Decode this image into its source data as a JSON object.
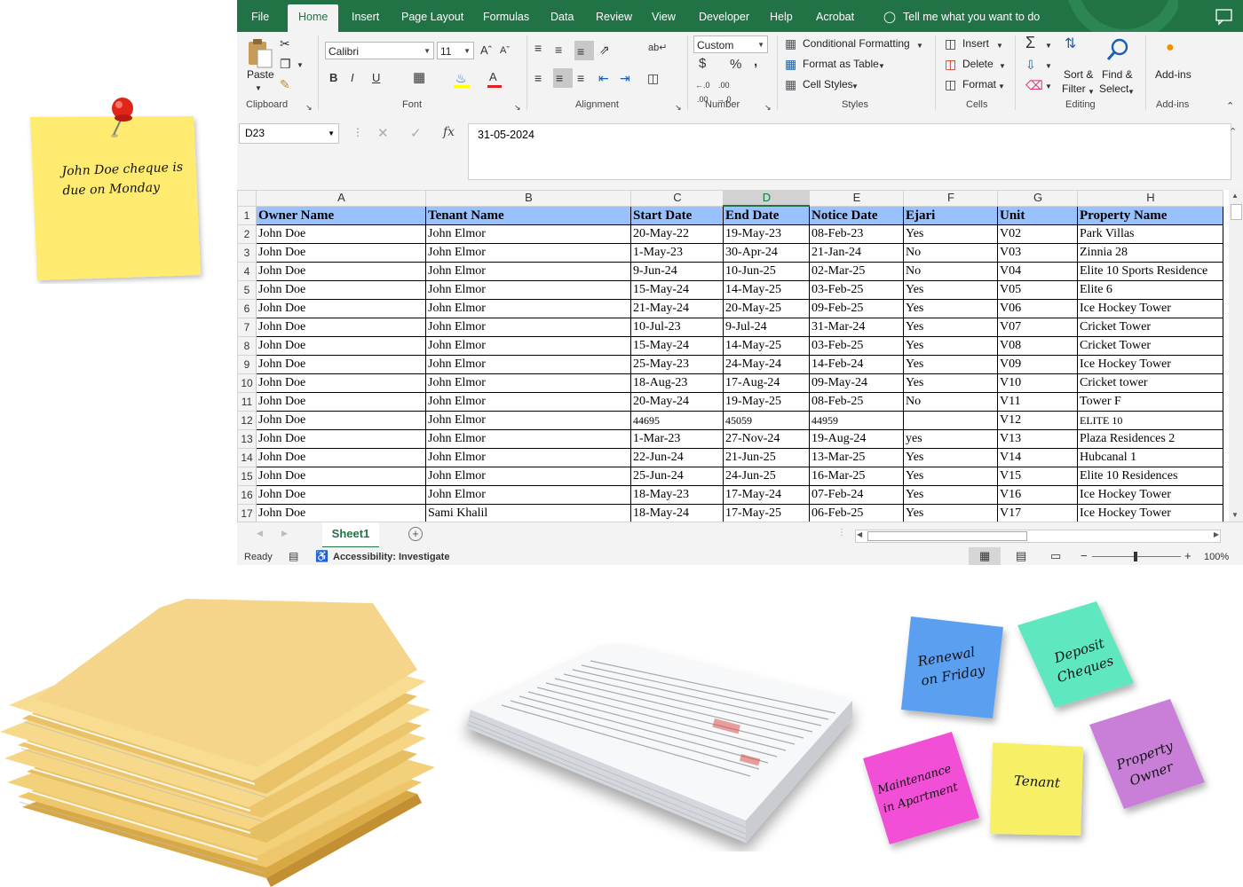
{
  "ribbon_tabs": [
    "File",
    "Home",
    "Insert",
    "Page Layout",
    "Formulas",
    "Data",
    "Review",
    "View",
    "Developer",
    "Help",
    "Acrobat"
  ],
  "tell_me": "Tell me what you want to do",
  "clipboard": {
    "paste": "Paste",
    "group": "Clipboard"
  },
  "font": {
    "name": "Calibri",
    "size": "11",
    "group": "Font"
  },
  "alignment": {
    "group": "Alignment"
  },
  "number": {
    "format": "Custom",
    "group": "Number",
    "currency": "$",
    "percent": "%",
    "comma": ","
  },
  "styles": {
    "conditional": "Conditional Formatting",
    "format_table": "Format as Table",
    "cell_styles": "Cell Styles",
    "group": "Styles"
  },
  "cells": {
    "insert": "Insert",
    "delete": "Delete",
    "format": "Format",
    "group": "Cells"
  },
  "editing": {
    "sort": "Sort &",
    "filter": "Filter",
    "find": "Find &",
    "select": "Select",
    "group": "Editing"
  },
  "addins": {
    "label": "Add-ins",
    "group": "Add-ins"
  },
  "name_box": "D23",
  "formula_value": "31-05-2024",
  "columns": [
    "A",
    "B",
    "C",
    "D",
    "E",
    "F",
    "G",
    "H"
  ],
  "headers": [
    "Owner Name",
    "Tenant Name",
    "Start Date",
    "End Date",
    "Notice Date",
    "Ejari",
    "Unit",
    "Property Name"
  ],
  "rows": [
    [
      "John Doe",
      "John Elmor",
      "20-May-22",
      "19-May-23",
      "08-Feb-23",
      "Yes",
      "V02",
      "Park Villas"
    ],
    [
      "John Doe",
      "John Elmor",
      "1-May-23",
      "30-Apr-24",
      "21-Jan-24",
      "No",
      "V03",
      "Zinnia 28"
    ],
    [
      "John Doe",
      "John Elmor",
      "9-Jun-24",
      "10-Jun-25",
      "02-Mar-25",
      "No",
      "V04",
      "Elite 10 Sports Residence"
    ],
    [
      "John Doe",
      "John Elmor",
      "15-May-24",
      "14-May-25",
      "03-Feb-25",
      "Yes",
      "V05",
      "Elite 6"
    ],
    [
      "John Doe",
      "John Elmor",
      "21-May-24",
      "20-May-25",
      "09-Feb-25",
      "Yes",
      "V06",
      "Ice Hockey Tower"
    ],
    [
      "John Doe",
      "John Elmor",
      "10-Jul-23",
      "9-Jul-24",
      "31-Mar-24",
      "Yes",
      "V07",
      "Cricket Tower"
    ],
    [
      "John Doe",
      "John Elmor",
      "15-May-24",
      "14-May-25",
      "03-Feb-25",
      "Yes",
      "V08",
      "Cricket Tower"
    ],
    [
      "John Doe",
      "John Elmor",
      "25-May-23",
      "24-May-24",
      "14-Feb-24",
      "Yes",
      "V09",
      "Ice Hockey Tower"
    ],
    [
      "John Doe",
      "John Elmor",
      "18-Aug-23",
      "17-Aug-24",
      "09-May-24",
      "Yes",
      "V10",
      "Cricket tower"
    ],
    [
      "John Doe",
      "John Elmor",
      "20-May-24",
      "19-May-25",
      "08-Feb-25",
      "No",
      "V11",
      "Tower F"
    ],
    [
      "John Doe",
      "John Elmor",
      "44695",
      "45059",
      "44959",
      "",
      "V12",
      "ELITE 10"
    ],
    [
      "John Doe",
      "John Elmor",
      "1-Mar-23",
      "27-Nov-24",
      "19-Aug-24",
      "yes",
      "V13",
      "Plaza Residences 2"
    ],
    [
      "John Doe",
      "John Elmor",
      "22-Jun-24",
      "21-Jun-25",
      "13-Mar-25",
      "Yes",
      "V14",
      "Hubcanal 1"
    ],
    [
      "John Doe",
      "John Elmor",
      "25-Jun-24",
      "24-Jun-25",
      "16-Mar-25",
      "Yes",
      "V15",
      "Elite 10 Residences"
    ],
    [
      "John Doe",
      "John Elmor",
      "18-May-23",
      "17-May-24",
      "07-Feb-24",
      "Yes",
      "V16",
      "Ice Hockey Tower"
    ],
    [
      "John Doe",
      "Sami Khalil",
      "18-May-24",
      "17-May-25",
      "06-Feb-25",
      "Yes",
      "V17",
      "Ice Hockey Tower"
    ]
  ],
  "sheet_tab": "Sheet1",
  "status": {
    "ready": "Ready",
    "accessibility": "Accessibility: Investigate",
    "zoom": "100%"
  },
  "notes": {
    "main": "John Doe cheque is due on Monday",
    "blue": "Renewal on Friday",
    "green": "Deposit Cheques",
    "pink": "Maintenance in Apartment",
    "yellow": "Tenant",
    "purple": "Property Owner"
  },
  "colors": {
    "excel_green": "#217346",
    "header_fill": "#99c1ff",
    "note_yellow": "#ffeb70",
    "note_blue": "#5a9ff0",
    "note_green": "#5ee8bf",
    "note_pink": "#f050d6",
    "note_purple": "#c97fd8"
  }
}
